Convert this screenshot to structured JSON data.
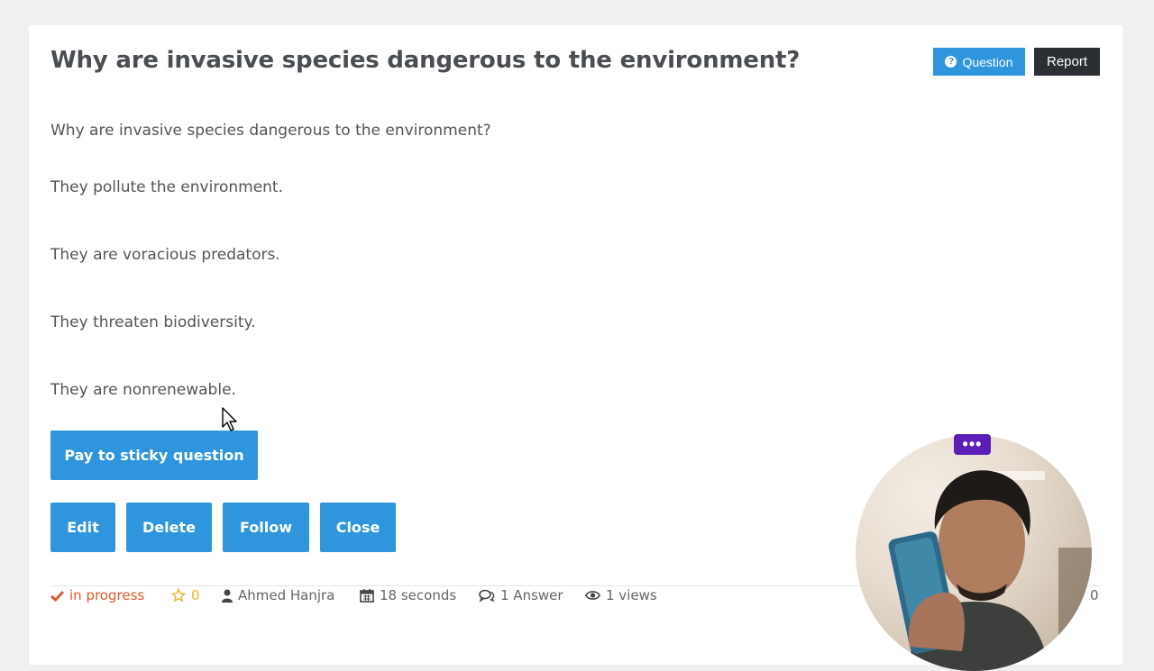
{
  "question": {
    "title": "Why are invasive species dangerous to the environment?",
    "body": "Why are invasive species dangerous to the environment?",
    "options": [
      "They pollute the environment.",
      "They are voracious predators.",
      "They threaten biodiversity.",
      "They are nonrenewable."
    ]
  },
  "tags": {
    "question_label": "Question",
    "report_label": "Report"
  },
  "actions": {
    "sticky_label": "Pay to sticky question",
    "edit_label": "Edit",
    "delete_label": "Delete",
    "follow_label": "Follow",
    "close_label": "Close"
  },
  "meta": {
    "status": "in progress",
    "stars": "0",
    "author": "Ahmed Hanjra",
    "time": "18 seconds",
    "answers": "1 Answer",
    "views": "1 views",
    "votes": "0"
  },
  "overlay": {
    "menu_label": "•••"
  },
  "icons": {
    "status": "check-icon",
    "stars": "star-icon",
    "author": "user-icon",
    "time": "calendar-icon",
    "answers": "comments-icon",
    "views": "eye-icon"
  },
  "colors": {
    "accent": "#2f95dc",
    "dark": "#2b2e33",
    "status": "#e0592a",
    "star": "#e6b429",
    "overlay": "#5b1fb7"
  }
}
